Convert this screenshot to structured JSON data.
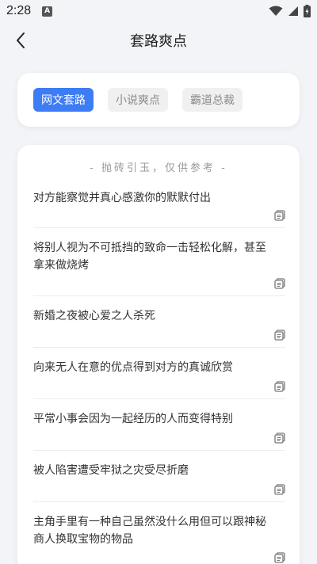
{
  "status": {
    "time": "2:28",
    "notif_letter": "A"
  },
  "header": {
    "title": "套路爽点"
  },
  "tabs": [
    {
      "label": "网文套路",
      "active": true
    },
    {
      "label": "小说爽点",
      "active": false
    },
    {
      "label": "霸道总裁",
      "active": false
    }
  ],
  "list": {
    "subtitle": "- 抛砖引玉，仅供参考 -",
    "items": [
      {
        "text": "对方能察觉并真心感激你的默默付出"
      },
      {
        "text": "将别人视为不可抵挡的致命一击轻松化解，甚至拿来做烧烤"
      },
      {
        "text": "新婚之夜被心爱之人杀死"
      },
      {
        "text": "向来无人在意的优点得到对方的真诚欣赏"
      },
      {
        "text": "平常小事会因为一起经历的人而变得特别"
      },
      {
        "text": "被人陷害遭受牢狱之灾受尽折磨"
      },
      {
        "text": "主角手里有一种自己虽然没什么用但可以跟神秘商人换取宝物的物品"
      }
    ]
  },
  "colors": {
    "accent": "#3d7cf5",
    "background": "#f2f4f7"
  }
}
